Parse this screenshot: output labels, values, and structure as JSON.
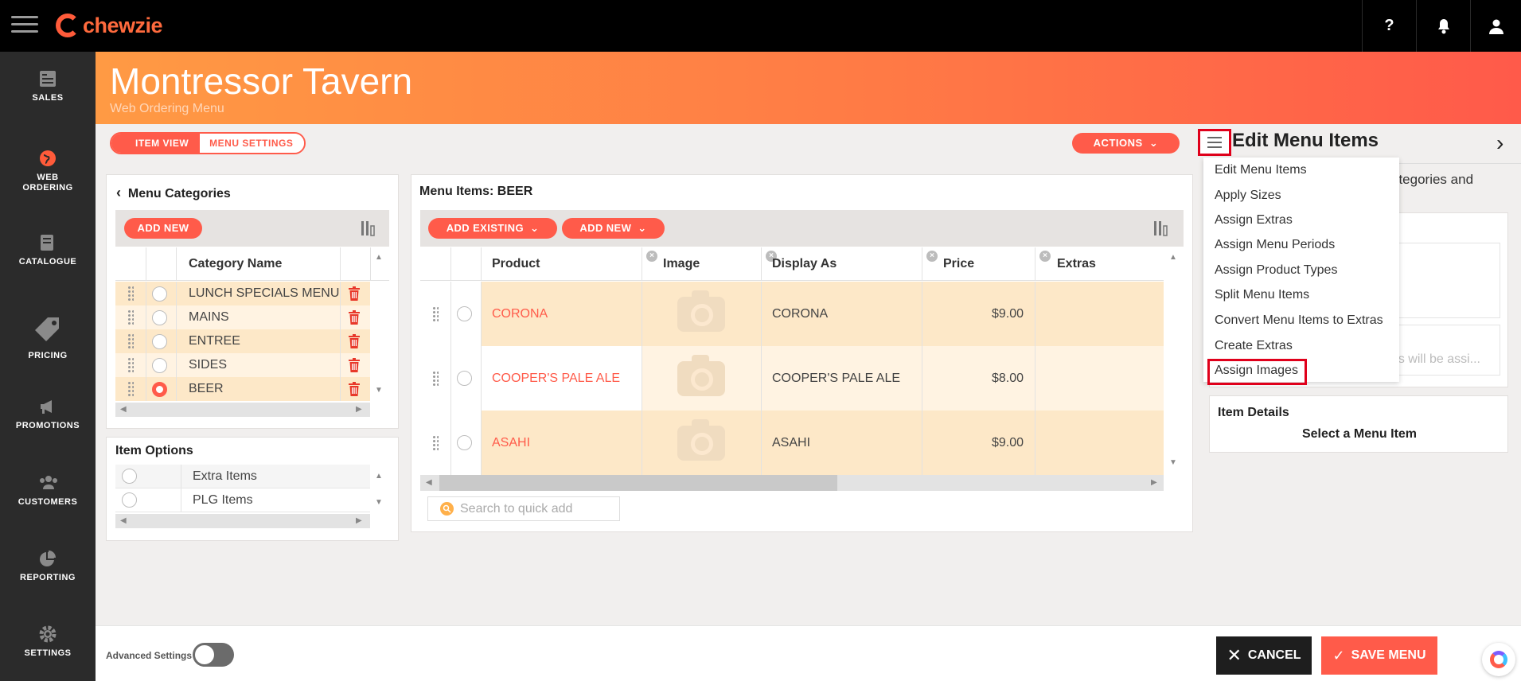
{
  "app": {
    "logo_text": "chewzie"
  },
  "topbar": {
    "help_label": "?",
    "bell_icon": "bell-icon",
    "user_icon": "user-icon"
  },
  "nav": [
    {
      "label": "SALES",
      "icon": "sales-icon"
    },
    {
      "label": "WEB ORDERING",
      "icon": "globe-icon"
    },
    {
      "label": "CATALOGUE",
      "icon": "catalogue-icon"
    },
    {
      "label": "PRICING",
      "icon": "tag-icon"
    },
    {
      "label": "PROMOTIONS",
      "icon": "megaphone-icon"
    },
    {
      "label": "CUSTOMERS",
      "icon": "people-icon"
    },
    {
      "label": "REPORTING",
      "icon": "pie-chart-icon"
    },
    {
      "label": "SETTINGS",
      "icon": "gear-icon"
    }
  ],
  "header": {
    "title": "Montressor Tavern",
    "subtitle": "Web Ordering Menu"
  },
  "tabs": {
    "item_view": "ITEM VIEW",
    "menu_settings": "MENU SETTINGS"
  },
  "actions_label": "ACTIONS",
  "categories": {
    "title": "Menu Categories",
    "add_new": "ADD NEW",
    "column": "Category Name",
    "rows": [
      {
        "name": "LUNCH SPECIALS MENU",
        "selected": false
      },
      {
        "name": "MAINS",
        "selected": false
      },
      {
        "name": "ENTREE",
        "selected": false
      },
      {
        "name": "SIDES",
        "selected": false
      },
      {
        "name": "BEER",
        "selected": true
      }
    ]
  },
  "item_options": {
    "title": "Item Options",
    "rows": [
      {
        "name": "Extra Items"
      },
      {
        "name": "PLG Items"
      }
    ]
  },
  "menu_items": {
    "title": "Menu Items: BEER",
    "add_existing": "ADD EXISTING",
    "add_new": "ADD NEW",
    "columns": {
      "product": "Product",
      "image": "Image",
      "display_as": "Display As",
      "price": "Price",
      "extras": "Extras"
    },
    "rows": [
      {
        "product": "CORONA",
        "display_as": "CORONA",
        "price": "$9.00"
      },
      {
        "product": "COOPER'S PALE ALE",
        "display_as": "COOPER'S PALE ALE",
        "price": "$8.00"
      },
      {
        "product": "ASAHI",
        "display_as": "ASAHI",
        "price": "$9.00"
      }
    ],
    "search_placeholder": "Search to quick add"
  },
  "drawer": {
    "title": "Edit Menu Items",
    "partial_text_1": "ategories and",
    "partial_text_2": "s will be assi...",
    "item_details_title": "Item Details",
    "item_details_msg": "Select a Menu Item",
    "menu": [
      "Edit Menu Items",
      "Apply Sizes",
      "Assign Extras",
      "Assign Menu Periods",
      "Assign Product Types",
      "Split Menu Items",
      "Convert Menu Items to Extras",
      "Create Extras",
      "Assign Images"
    ]
  },
  "footer": {
    "advanced_settings": "Advanced Settings",
    "cancel": "CANCEL",
    "save": "SAVE MENU"
  },
  "colors": {
    "accent": "#ff5b4a",
    "highlight_border": "#e0001b",
    "row_alt": "#fde8c8"
  }
}
